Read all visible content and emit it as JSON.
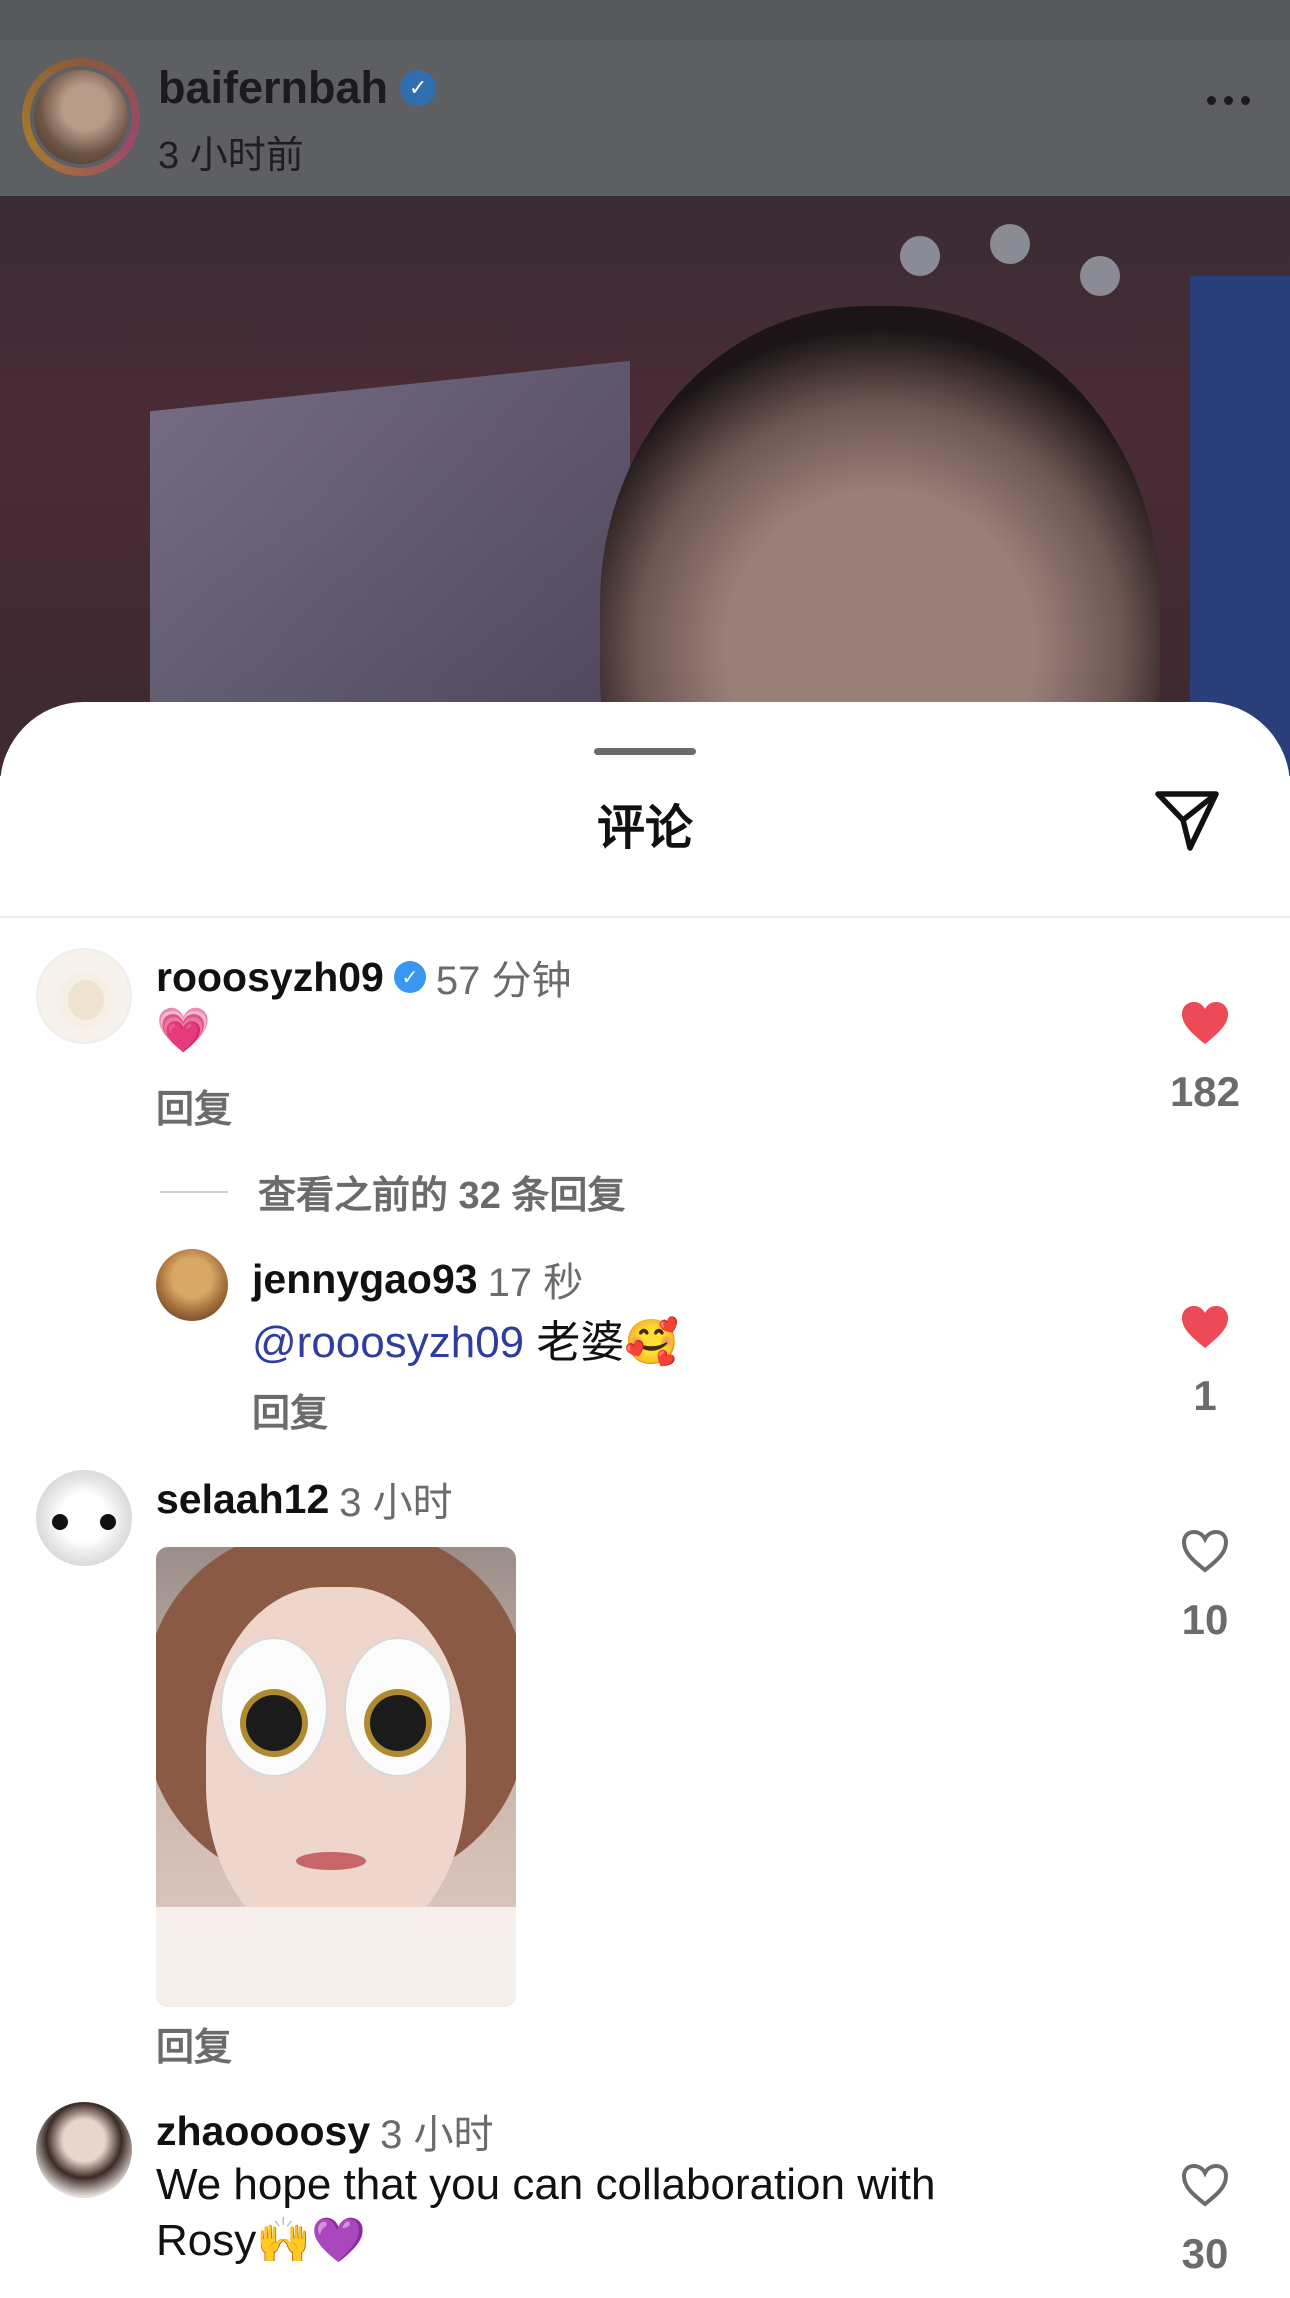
{
  "post": {
    "username": "baifernbah",
    "time": "3 小时前"
  },
  "sheet": {
    "title": "评论"
  },
  "comments": [
    {
      "username": "rooosyzh09",
      "verified": true,
      "time": "57 分钟",
      "text": "💗",
      "reply": "回复",
      "likes": "182",
      "liked": true
    },
    {
      "view_more": "查看之前的 32 条回复"
    },
    {
      "username": "jennygao93",
      "time": "17 秒",
      "mention": "@rooosyzh09",
      "text": " 老婆🥰",
      "reply": "回复",
      "likes": "1",
      "liked": true
    },
    {
      "username": "selaah12",
      "time": "3 小时",
      "reply": "回复",
      "likes": "10",
      "liked": false
    },
    {
      "username": "zhaoooosy",
      "time": "3 小时",
      "text_line1": "We hope that you can collaboration with",
      "text_line2": "Rosy🙌💜",
      "likes": "30",
      "liked": false
    }
  ],
  "colors": {
    "like_red": "#ed4956",
    "mention_blue": "#2e3d9e",
    "verified_blue": "#3897f0"
  },
  "icons": [
    "more-icon",
    "verified-icon",
    "send-icon",
    "heart-filled-icon",
    "heart-outline-icon"
  ]
}
